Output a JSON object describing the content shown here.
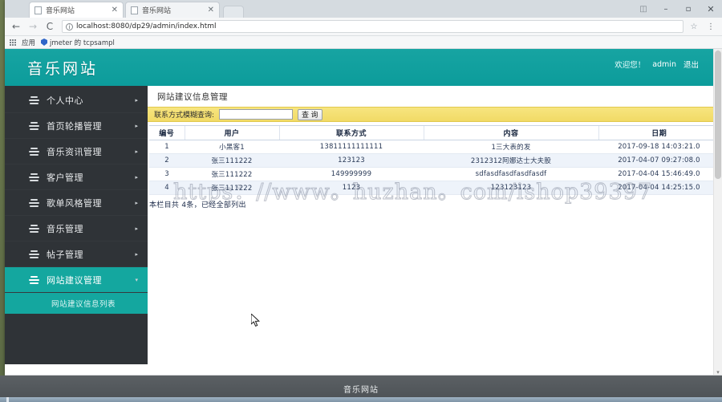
{
  "browser": {
    "tabs": [
      {
        "title": "音乐网站",
        "active": true,
        "close_label": "✕"
      },
      {
        "title": "音乐网站",
        "active": false,
        "close_label": "✕"
      }
    ],
    "window_controls": {
      "account": "◫",
      "minimize": "–",
      "maximize": "▫",
      "close": "✕"
    },
    "nav": {
      "back": "←",
      "forward": "→",
      "reload": "C",
      "info_icon": "i",
      "url": "localhost:8080/dp29/admin/index.html",
      "star": "☆",
      "menu": "⋮"
    },
    "bookmarks": [
      {
        "label": "应用",
        "icon": "apps-grid-icon"
      },
      {
        "label": "jmeter 的 tcpsampl",
        "icon": "shield-icon"
      }
    ]
  },
  "site": {
    "title": "音乐网站",
    "user_area": {
      "welcome": "欢迎您！",
      "username": "admin",
      "logout": "退出"
    }
  },
  "sidebar": {
    "items": [
      {
        "label": "个人中心",
        "caret": "▸",
        "active": false
      },
      {
        "label": "首页轮播管理",
        "caret": "▸",
        "active": false
      },
      {
        "label": "音乐资讯管理",
        "caret": "▸",
        "active": false
      },
      {
        "label": "客户管理",
        "caret": "▸",
        "active": false
      },
      {
        "label": "歌单风格管理",
        "caret": "▸",
        "active": false
      },
      {
        "label": "音乐管理",
        "caret": "▸",
        "active": false
      },
      {
        "label": "帖子管理",
        "caret": "▸",
        "active": false
      },
      {
        "label": "网站建议管理",
        "caret": "▾",
        "active": true
      }
    ],
    "submenu": [
      {
        "label": "网站建议信息列表"
      }
    ]
  },
  "content": {
    "title": "网站建议信息管理",
    "search": {
      "label": "联系方式模糊查询:",
      "value": "",
      "placeholder": "",
      "button": "查 询"
    },
    "table": {
      "headers": [
        "编号",
        "用户",
        "联系方式",
        "内容",
        "日期"
      ],
      "rows": [
        [
          "1",
          "小黑客1",
          "13811111111111",
          "1三大表的发",
          "2017-09-18 14:03:21.0"
        ],
        [
          "2",
          "张三111222",
          "123123",
          "2312312阿娜达士大夫股",
          "2017-04-07 09:27:08.0"
        ],
        [
          "3",
          "张三111222",
          "149999999",
          "sdfasdfasdfasdfasdf",
          "2017-04-04 15:46:49.0"
        ],
        [
          "4",
          "张三111222",
          "1123",
          "123123123",
          "2017-04-04 14:25:15.0"
        ]
      ]
    },
    "list_note": "本栏目共 4条，已经全部列出",
    "watermark": "https：//www。huzhan。com/ishop39397"
  },
  "taskbar": {
    "label": "音乐网站"
  },
  "colors": {
    "brand_teal": "#0f9e9e",
    "sidebar_dark": "#2f3337",
    "active_teal": "#14a79f",
    "search_yellow": "#f5e27a",
    "taskbar_gray": "#53585c"
  }
}
